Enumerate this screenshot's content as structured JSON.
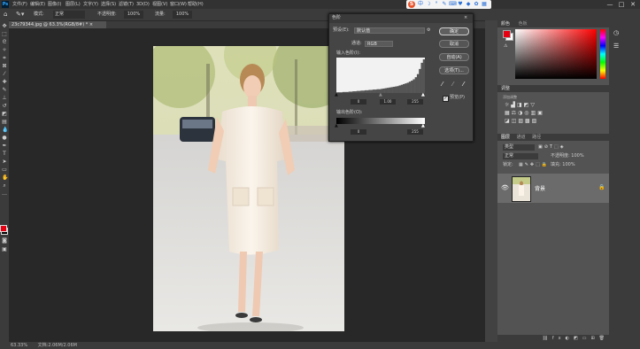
{
  "menubar": {
    "logo": "Ps",
    "items": [
      "文件(F)",
      "编辑(E)",
      "图像(I)",
      "图层(L)",
      "文字(Y)",
      "选择(S)",
      "滤镜(T)",
      "3D(D)",
      "视图(V)",
      "窗口(W)",
      "帮助(H)"
    ],
    "window_controls": [
      "—",
      "□",
      "✕"
    ]
  },
  "ime_bar": {
    "logo": "S",
    "items": [
      "中",
      "☽",
      "°",
      "✎",
      "⌨",
      "♥",
      "◆",
      "✿",
      "▦"
    ]
  },
  "options_bar": {
    "mode_label": "模式:",
    "mode_value": "正常",
    "opacity_label": "不透明度:",
    "opacity_value": "100%",
    "flow_label": "流量:",
    "flow_value": "100%"
  },
  "document_tab": {
    "label": "23c79344.jpg @ 63.3%(RGB/8#) *",
    "close": "×"
  },
  "status_bar": {
    "zoom": "63.33%",
    "doc_info": "文档:2.06M/2.06M"
  },
  "dialog": {
    "title": "色阶",
    "close": "×",
    "preset_label": "预设(E):",
    "preset_value": "默认值",
    "channel_label": "通道:",
    "channel_value": "RGB",
    "input_label": "输入色阶(I):",
    "input_values": [
      "0",
      "1.00",
      "255"
    ],
    "output_label": "输出色阶(O):",
    "output_values": [
      "0",
      "255"
    ],
    "buttons": {
      "ok": "确定",
      "cancel": "取消",
      "auto": "自动(A)",
      "options": "选项(T)..."
    },
    "preview_label": "预览(P)",
    "preview_checked": true,
    "histogram": [
      2,
      2,
      2,
      3,
      3,
      3,
      4,
      4,
      5,
      5,
      6,
      6,
      7,
      7,
      8,
      8,
      9,
      9,
      10,
      10,
      11,
      11,
      12,
      13,
      14,
      15,
      16,
      17,
      18,
      19,
      20,
      22,
      24,
      26,
      28,
      30,
      33,
      36,
      40,
      46,
      55,
      70,
      88,
      98
    ]
  },
  "color_panel": {
    "title": "颜色",
    "alt_title": "色板",
    "foreground": "#e60012",
    "background": "#ffffff"
  },
  "adjustments_panel": {
    "title": "调整",
    "subtitle": "添加调整"
  },
  "layers_panel": {
    "tabs": [
      "图层",
      "通道",
      "路径"
    ],
    "filter_label": "类型",
    "blend_mode": "正常",
    "opacity_label": "不透明度: 100%",
    "fill_label": "填充: 100%",
    "lock_label": "锁定:",
    "layers": [
      {
        "name": "背景",
        "visible": true,
        "locked": true
      }
    ]
  },
  "colors": {
    "accent": "#31a8ff",
    "fg_swatch": "#e60012",
    "panel_bg": "#535353",
    "canvas_bg": "#282828"
  }
}
